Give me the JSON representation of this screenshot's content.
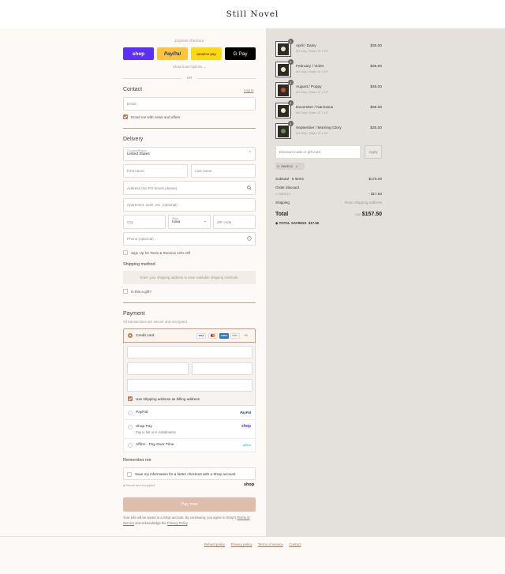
{
  "brand": "Still Novel",
  "express": {
    "title": "Express checkout",
    "buttons": [
      "shop",
      "PayPal",
      "amazon pay",
      "G Pay"
    ],
    "show_more": "Show more options",
    "or": "OR"
  },
  "contact": {
    "title": "Contact",
    "login": "Log in",
    "email_placeholder": "Email",
    "news_label": "Email me with news and offers"
  },
  "delivery": {
    "title": "Delivery",
    "country_label": "Country/Region",
    "country_value": "United States",
    "first_name": "First name",
    "last_name": "Last name",
    "address": "Address (No PO boxes please)",
    "apartment": "Apartment, suite, etc. (optional)",
    "city": "City",
    "state_label": "State",
    "state_value": "Iowa",
    "zip": "ZIP code",
    "phone": "Phone (optional)",
    "sms_label": "Sign Up for Texts & Receive 10% Off",
    "shipping_method_title": "Shipping method",
    "shipping_method_note": "Enter your shipping address to view available shipping methods.",
    "gift_label": "Is this a gift?"
  },
  "payment": {
    "title": "Payment",
    "subtitle": "All transactions are secure and encrypted.",
    "credit_card": "Credit card",
    "cards": [
      "VISA",
      "MC",
      "AMEX",
      "DISC"
    ],
    "more_cards": "+6",
    "billing_label": "Use shipping address as billing address",
    "paypal": "PayPal",
    "paypal_logo": "PayPal",
    "shoppay": "Shop Pay",
    "shoppay_sub": "Pay in full or in installments",
    "shoppay_logo": "shop",
    "affirm": "Affirm - Pay Over Time",
    "affirm_logo": "affirm"
  },
  "remember": {
    "title": "Remember me",
    "save_label": "Save my information for a faster checkout with a Shop account",
    "secure": "Secure and encrypted",
    "shop_logo": "shop"
  },
  "pay_now": "Pay now",
  "legal": {
    "line1": "Your info will be saved to a Shop account. By continuing, you agree to Shop's",
    "tos": "Terms of Service",
    "and": "and acknowledge the",
    "privacy": "Privacy Policy"
  },
  "footer_links": [
    "Refund policy",
    "Privacy policy",
    "Terms of service",
    "Contact"
  ],
  "cart": {
    "items": [
      {
        "name": "April / Daisy",
        "variant": "Art Only / Dark / 8\" x 10\"",
        "price": "$35.00",
        "qty": "1",
        "flower": "#e8e2c8"
      },
      {
        "name": "February / Violet",
        "variant": "Art Only / Dark / 8\" x 10\"",
        "price": "$35.00",
        "qty": "1",
        "flower": "#ece6d2"
      },
      {
        "name": "August / Poppy",
        "variant": "Art Only / Dark / 8\" x 10\"",
        "price": "$35.00",
        "qty": "1",
        "flower": "#c2522e"
      },
      {
        "name": "December / Narcissus",
        "variant": "Art Only / Dark / 8\" x 10\"",
        "price": "$35.00",
        "qty": "1",
        "flower": "#efe9cf"
      },
      {
        "name": "September / Morning Glory",
        "variant": "Art Only / Dark / 8\" x 10\"",
        "price": "$35.00",
        "qty": "1",
        "flower": "#6a8a5a"
      }
    ],
    "discount_placeholder": "Discount code or gift card",
    "apply": "Apply",
    "code_tag": "SAVE10",
    "subtotal_label": "Subtotal · 5 items",
    "subtotal": "$175.00",
    "order_discount": "Order discount",
    "discount_code": "SAVE10",
    "discount_amount": "- $17.50",
    "shipping_label": "Shipping",
    "shipping_value": "Enter shipping address",
    "total_label": "Total",
    "currency": "USD",
    "total": "$157.50",
    "savings_label": "TOTAL SAVINGS",
    "savings": "$17.50"
  },
  "colors": {
    "accent": "#b97e5f",
    "pay_button": "#dfbdac",
    "shop": "#5a31f4",
    "paypal": "#ffc439",
    "amazon": "#ffd814"
  }
}
